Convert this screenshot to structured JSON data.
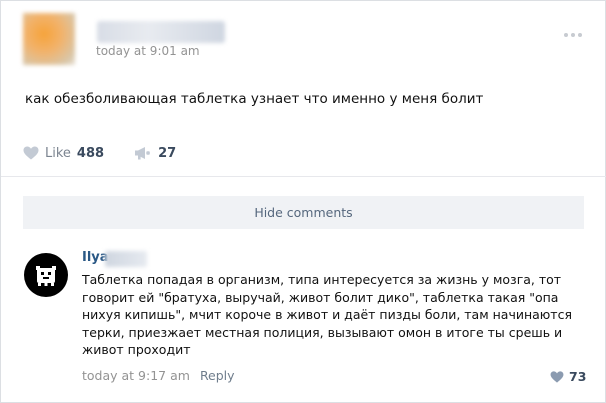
{
  "post": {
    "time": "today at 9:01 am",
    "text": "как обезболивающая таблетка узнает что именно у меня болит",
    "like_label": "Like",
    "like_count": "488",
    "share_count": "27"
  },
  "comments_toggle": {
    "label": "Hide comments"
  },
  "comment": {
    "author": "Ilya",
    "lines": [
      "Таблетка попадая в организм, типа интересуется за жизнь у мозга, тот",
      "говорит ей \"братуха, выручай, живот болит дико\", таблетка такая \"опа",
      "нихуя кипишь\", мчит короче в живот и даёт пизды боли, там начинаются",
      "терки, приезжает местная полиция, вызывают омон в итоге ты срешь и",
      "живот проходит"
    ],
    "time": "today at 9:17 am",
    "reply_label": "Reply",
    "like_count": "73"
  },
  "colors": {
    "link_blue": "#2a5885",
    "muted_gray": "#939393",
    "button_bg": "#f0f2f5",
    "page_bg": "#edeef0"
  },
  "icons": [
    "heart-icon",
    "megaphone-icon",
    "more-dots-icon"
  ]
}
